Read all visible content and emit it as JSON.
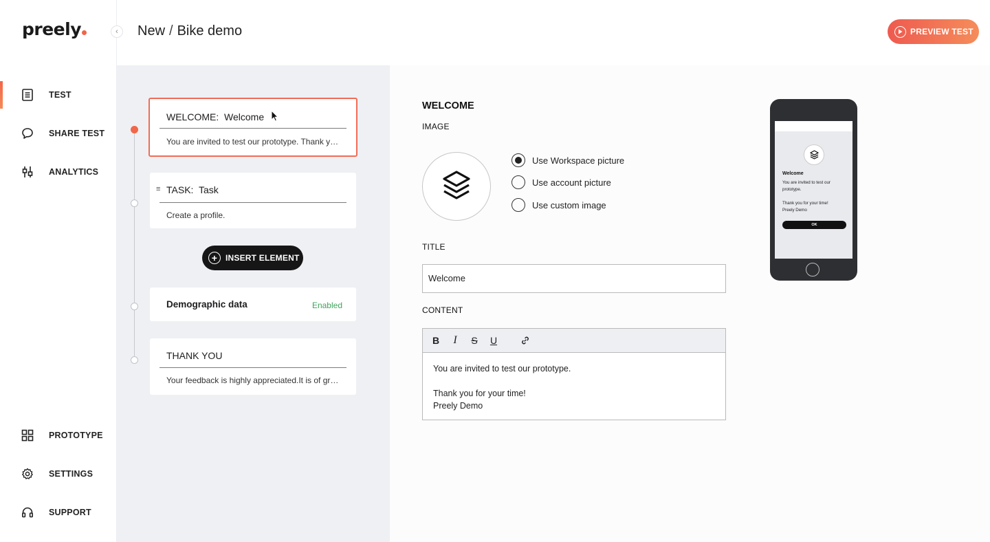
{
  "brand": {
    "logo_text": "preely",
    "accent_color": "#f26649"
  },
  "sidebar": {
    "collapse_icon": "chevron-left-icon",
    "top_items": [
      {
        "label": "TEST",
        "icon": "document-icon",
        "active": true
      },
      {
        "label": "SHARE TEST",
        "icon": "chat-bubble-icon",
        "active": false
      },
      {
        "label": "ANALYTICS",
        "icon": "sliders-icon",
        "active": false
      }
    ],
    "bottom_items": [
      {
        "label": "PROTOTYPE",
        "icon": "grid-icon"
      },
      {
        "label": "SETTINGS",
        "icon": "gear-icon"
      },
      {
        "label": "SUPPORT",
        "icon": "headset-icon"
      }
    ]
  },
  "header": {
    "breadcrumb_parent": "New",
    "breadcrumb_separator": "/",
    "breadcrumb_current": "Bike demo",
    "preview_button": "PREVIEW TEST"
  },
  "flow": {
    "cards": [
      {
        "type": "WELCOME:",
        "title": "Welcome",
        "text": "You are invited to test our prototype. Thank you for your time! Preely Demo",
        "selected": true
      },
      {
        "type": "TASK:",
        "title": "Task",
        "text": "Create a profile.",
        "selected": false
      },
      {
        "title": "Demographic data",
        "status": "Enabled"
      },
      {
        "title": "THANK YOU",
        "text": "Your feedback is highly appreciated.It is of great value to us."
      }
    ],
    "insert_button": "INSERT ELEMENT",
    "enabled_color": "#3fa45b"
  },
  "editor": {
    "section_title": "WELCOME",
    "image_label": "IMAGE",
    "image_options": [
      {
        "label": "Use Workspace picture",
        "checked": true
      },
      {
        "label": "Use account picture",
        "checked": false
      },
      {
        "label": "Use custom image",
        "checked": false
      }
    ],
    "title_label": "TITLE",
    "title_value": "Welcome",
    "content_label": "CONTENT",
    "toolbar": [
      "bold-icon",
      "italic-icon",
      "strikethrough-icon",
      "underline-icon",
      "link-icon"
    ],
    "toolbar_glyphs": {
      "bold": "B",
      "italic": "I",
      "strike": "S",
      "underline": "U"
    },
    "content_lines": [
      "You are invited to test our prototype.",
      "",
      "Thank you for your time!",
      "Preely Demo"
    ]
  },
  "phone_preview": {
    "title": "Welcome",
    "text_1": "You are invited to test our prototype.",
    "text_2": "Thank you for your time!",
    "text_3": "Preely Demo",
    "button": "OK"
  }
}
